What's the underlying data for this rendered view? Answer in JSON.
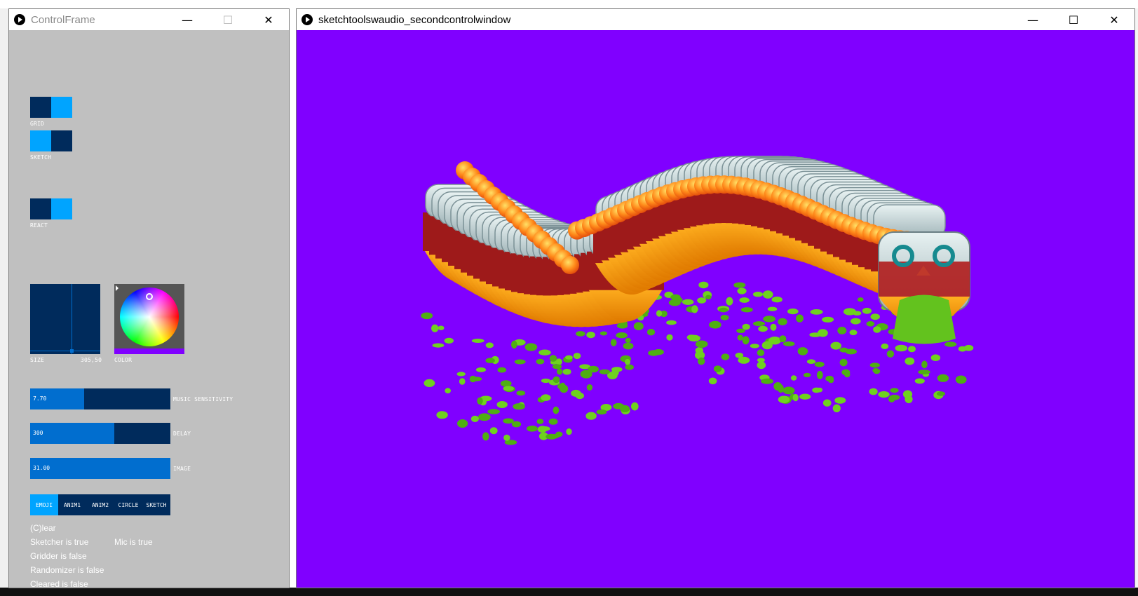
{
  "control_frame": {
    "title": "ControlFrame",
    "toggles": [
      {
        "label": "GRID",
        "state": "on"
      },
      {
        "label": "SKETCH",
        "state": "off"
      },
      {
        "label": "REACT",
        "state": "on"
      }
    ],
    "size_slider": {
      "label": "SIZE",
      "value_text": "305,50"
    },
    "color_picker": {
      "label": "COLOR",
      "selected_color": "#8000ff"
    },
    "sliders": [
      {
        "value": "7.70",
        "label": "MUSIC SENSITIVITY",
        "fill_fraction": 0.385
      },
      {
        "value": "300",
        "label": "DELAY",
        "fill_fraction": 0.6
      },
      {
        "value": "31.00",
        "label": "IMAGE",
        "fill_fraction": 1.0
      }
    ],
    "modes": [
      "EMOJI",
      "ANIM1",
      "ANIM2",
      "CIRCLE",
      "SKETCH"
    ],
    "active_mode": "EMOJI",
    "status": {
      "clear": "(C)lear",
      "sketcher": "Sketcher is true",
      "mic": "Mic is true",
      "gridder": "Gridder is false",
      "randomizer": "Randomizer is false",
      "cleared": "Cleared is false"
    }
  },
  "second_window": {
    "title": "sketchtoolswaudio_secondcontrolwindow",
    "background_color": "#8000ff"
  },
  "window_controls": {
    "minimize": "—",
    "maximize": "☐",
    "close": "✕"
  },
  "colors": {
    "dark": "#002b5c",
    "light": "#00a4ff",
    "fill": "#016ecf",
    "panel": "#c0c0c0"
  }
}
